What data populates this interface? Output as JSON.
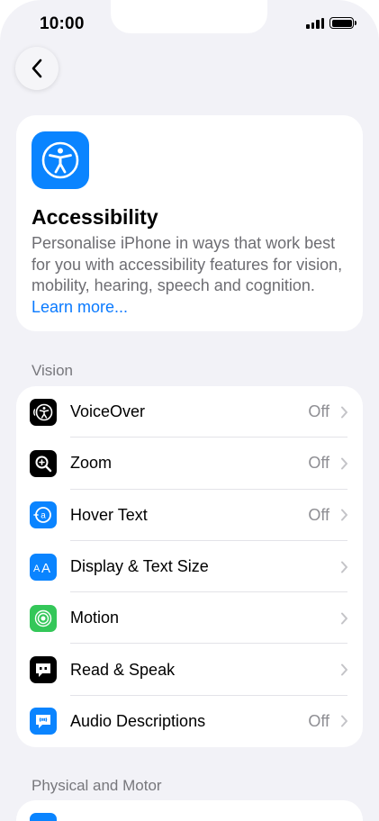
{
  "status_bar": {
    "time": "10:00"
  },
  "nav": {
    "back_icon": "chevron-left-icon"
  },
  "header": {
    "title": "Accessibility",
    "description": "Personalise iPhone in ways that work best for you with accessibility features for vision, mobility, hearing, speech and cognition.",
    "link": "Learn more...",
    "icon": "accessibility-icon",
    "icon_color": "#0a84ff"
  },
  "sections": {
    "vision": {
      "label": "Vision",
      "items": [
        {
          "label": "VoiceOver",
          "value": "Off",
          "icon": "voiceover-icon",
          "color": "#000000"
        },
        {
          "label": "Zoom",
          "value": "Off",
          "icon": "zoom-icon",
          "color": "#000000"
        },
        {
          "label": "Hover Text",
          "value": "Off",
          "icon": "hover-text-icon",
          "color": "#0a84ff"
        },
        {
          "label": "Display & Text Size",
          "value": "",
          "icon": "text-size-icon",
          "color": "#0a84ff"
        },
        {
          "label": "Motion",
          "value": "",
          "icon": "motion-icon",
          "color": "#34c759"
        },
        {
          "label": "Read & Speak",
          "value": "",
          "icon": "speech-bubble-icon",
          "color": "#000000"
        },
        {
          "label": "Audio Descriptions",
          "value": "Off",
          "icon": "audio-descriptions-icon",
          "color": "#0a84ff"
        }
      ]
    },
    "physical": {
      "label": "Physical and Motor"
    }
  }
}
